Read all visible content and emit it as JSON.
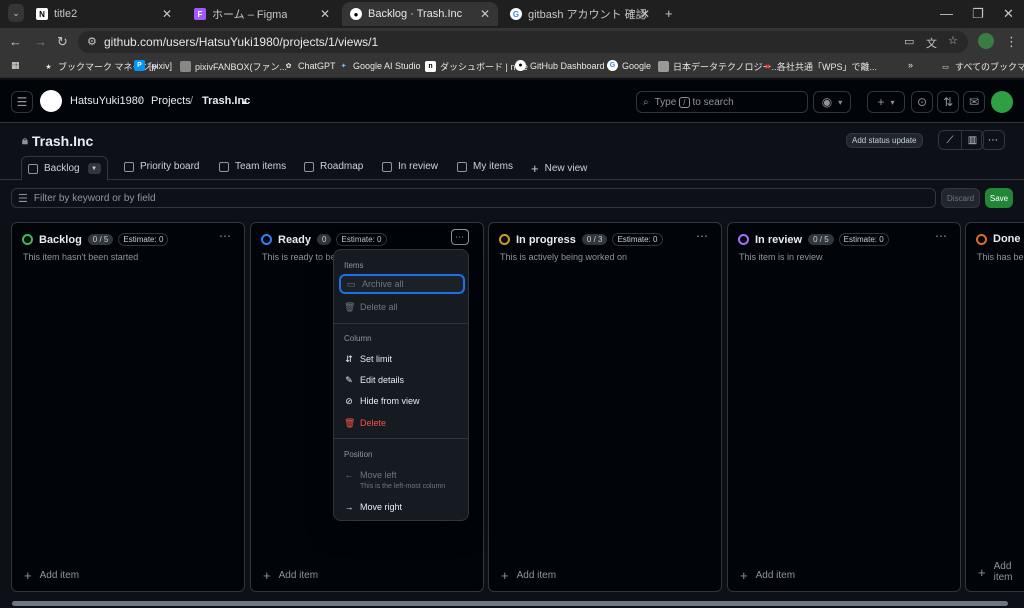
{
  "browser": {
    "tabs": [
      {
        "label": "title2",
        "icon": "notion-icon"
      },
      {
        "label": "ホーム – Figma",
        "icon": "figma-icon"
      },
      {
        "label": "Backlog · Trash.Inc",
        "icon": "github-icon"
      },
      {
        "label": "gitbash アカウント 確認 - Google",
        "icon": "google-icon"
      }
    ],
    "url": "github.com/users/HatsuYuki1980/projects/1/views/1",
    "bookmarks": [
      "ブックマーク マネージャ",
      "[pixiv]",
      "pixivFANBOX(ファン...",
      "ChatGPT",
      "Google AI Studio",
      "ダッシュボード | note",
      "GitHub Dashboard",
      "Google",
      "日本データテクノロジー...",
      "各社共通「WPS」で離...",
      "すべてのブックマーク"
    ]
  },
  "header": {
    "owner": "HatsuYuki1980",
    "projects": "Projects",
    "project": "Trash.Inc",
    "search_prefix": "Type",
    "search_key": "/",
    "search_suffix": "to search"
  },
  "project": {
    "title": "Trash.Inc",
    "status_button": "Add status update"
  },
  "views": [
    {
      "label": "Backlog"
    },
    {
      "label": "Priority board"
    },
    {
      "label": "Team items"
    },
    {
      "label": "Roadmap"
    },
    {
      "label": "In review"
    },
    {
      "label": "My items"
    },
    {
      "label": "New view"
    }
  ],
  "filter": {
    "placeholder": "Filter by keyword or by field",
    "discard": "Discard",
    "save": "Save"
  },
  "columns": [
    {
      "name": "Backlog",
      "count": "0 / 5",
      "estimate": "Estimate: 0",
      "desc": "This item hasn't been started",
      "color": "#3fb950",
      "add": "Add item"
    },
    {
      "name": "Ready",
      "count": "0",
      "estimate": "Estimate: 0",
      "desc": "This is ready to be",
      "color": "#2f81f7",
      "add": "Add item"
    },
    {
      "name": "In progress",
      "count": "0 / 3",
      "estimate": "Estimate: 0",
      "desc": "This is actively being worked on",
      "color": "#d29922",
      "add": "Add item"
    },
    {
      "name": "In review",
      "count": "0 / 5",
      "estimate": "Estimate: 0",
      "desc": "This item is in review",
      "color": "#a371f7",
      "add": "Add item"
    },
    {
      "name": "Done",
      "desc": "This has bee",
      "color": "#db6d28",
      "add": "Add item"
    }
  ],
  "menu": {
    "items_title": "Items",
    "archive_all": "Archive all",
    "delete_all": "Delete all",
    "column_title": "Column",
    "set_limit": "Set limit",
    "edit_details": "Edit details",
    "hide_from_view": "Hide from view",
    "delete": "Delete",
    "position_title": "Position",
    "move_left": "Move left",
    "move_left_sub": "This is the left-most column",
    "move_right": "Move right"
  }
}
